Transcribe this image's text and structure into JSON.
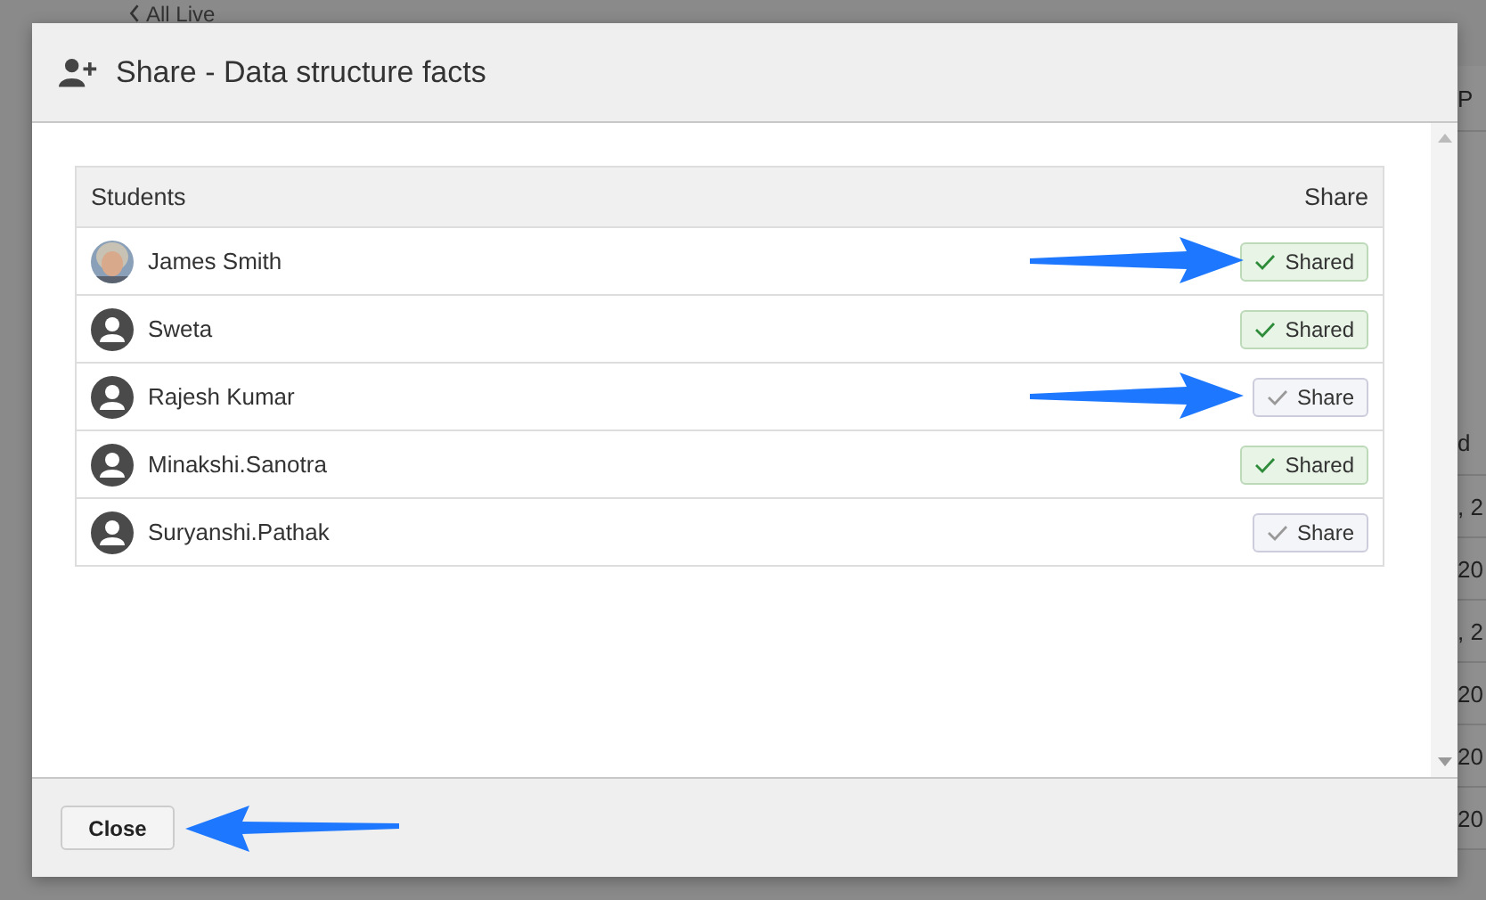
{
  "background": {
    "back_link": "All Live",
    "column_fragments": [
      "P",
      "d",
      ", 2",
      "20",
      ", 2",
      "20",
      "20",
      "20"
    ]
  },
  "dialog": {
    "title": "Share - Data structure facts",
    "table": {
      "columns": [
        "Students",
        "Share"
      ],
      "rows": [
        {
          "name": "James Smith",
          "shared": true,
          "label": "Shared",
          "arrow": true
        },
        {
          "name": "Sweta",
          "kind": "default",
          "shared": true,
          "label": "Shared",
          "arrow": false
        },
        {
          "name": "Rajesh Kumar",
          "kind": "default",
          "shared": false,
          "label": "Share",
          "arrow": true
        },
        {
          "name": "Minakshi.Sanotra",
          "kind": "default",
          "shared": true,
          "label": "Shared",
          "arrow": false
        },
        {
          "name": "Suryanshi.Pathak",
          "kind": "default",
          "shared": false,
          "label": "Share",
          "arrow": false
        }
      ]
    },
    "close_button": {
      "label": "Close",
      "arrow": true
    }
  }
}
